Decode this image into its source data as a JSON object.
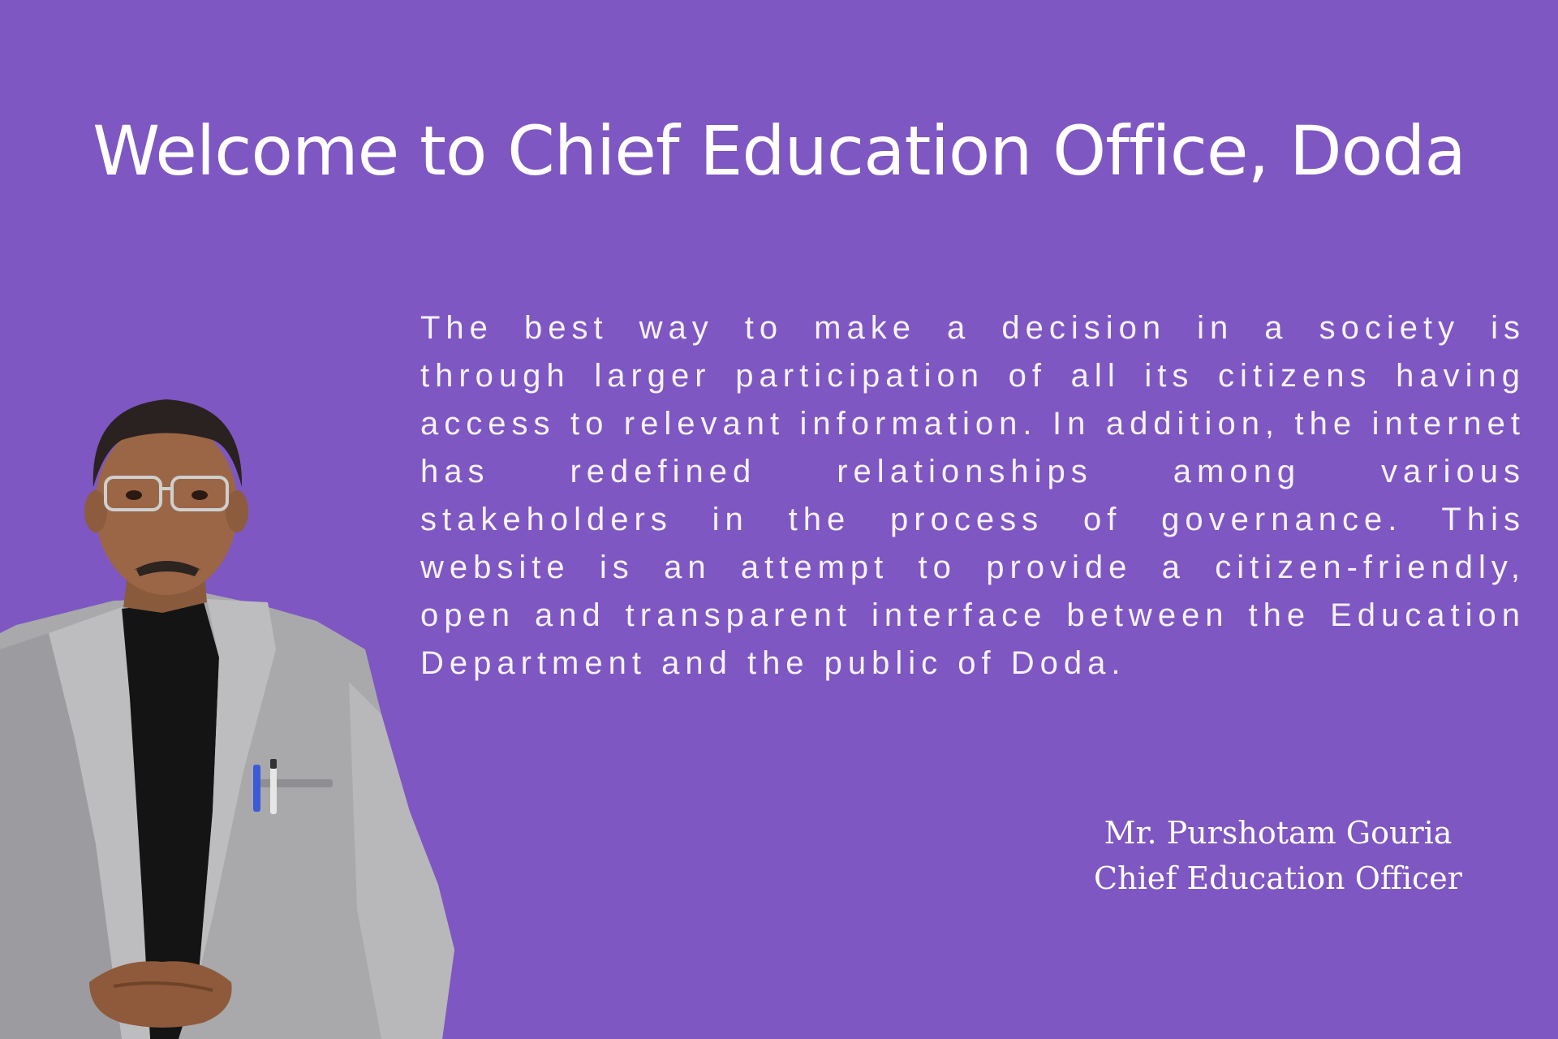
{
  "header": {
    "title": "Welcome to Chief Education Office, Doda"
  },
  "message": {
    "text": "The best way to make a decision in a society is through larger participation of all its citizens having access to relevant information. In addition, the internet has redefined relationships among various stakeholders in the process of governance. This website is an attempt to provide a citizen-friendly, open and transparent interface between the Education Department and the public of Doda."
  },
  "signature": {
    "name": "Mr. Purshotam Gouria",
    "designation": "Chief Education Officer"
  },
  "colors": {
    "background": "#7e57c2",
    "text": "#ffffff"
  }
}
